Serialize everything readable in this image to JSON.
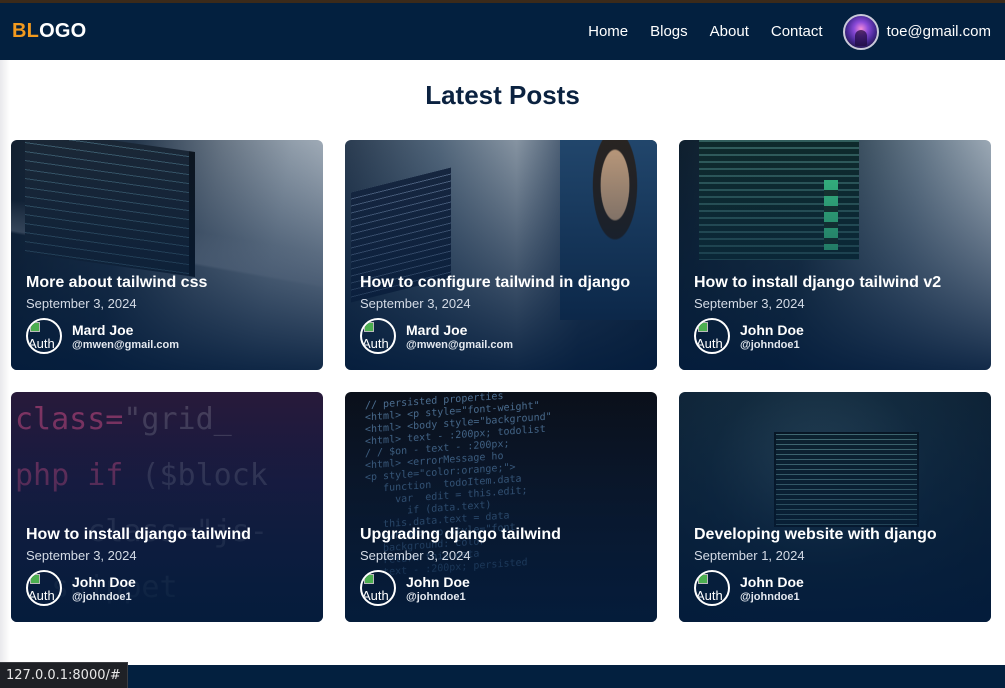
{
  "nav": {
    "logo_accent": "BL",
    "logo_rest": "OGO",
    "links": [
      "Home",
      "Blogs",
      "About",
      "Contact"
    ],
    "user_email": "toe@gmail.com"
  },
  "main": {
    "title": "Latest Posts",
    "posts": [
      {
        "title": "More about tailwind css",
        "date": "September 3, 2024",
        "author": "Mard Joe",
        "handle": "@mwen@gmail.com",
        "img_alt": "Auth"
      },
      {
        "title": "How to configure tailwind in django",
        "date": "September 3, 2024",
        "author": "Mard Joe",
        "handle": "@mwen@gmail.com",
        "img_alt": "Auth"
      },
      {
        "title": "How to install django tailwind v2",
        "date": "September 3, 2024",
        "author": "John Doe",
        "handle": "@johndoe1",
        "img_alt": "Auth"
      },
      {
        "title": "How to install django tailwind",
        "date": "September 3, 2024",
        "author": "John Doe",
        "handle": "@johndoe1",
        "img_alt": "Auth"
      },
      {
        "title": "Upgrading django tailwind",
        "date": "September 3, 2024",
        "author": "John Doe",
        "handle": "@johndoe1",
        "img_alt": "Auth"
      },
      {
        "title": "Developing website with django",
        "date": "September 1, 2024",
        "author": "John Doe",
        "handle": "@johndoe1",
        "img_alt": "Auth"
      }
    ]
  },
  "status_bar": {
    "url": "127.0.0.1:8000/#"
  },
  "colors": {
    "navbar": "#03203f",
    "logo_accent": "#f39a1e",
    "title": "#0b2240"
  }
}
